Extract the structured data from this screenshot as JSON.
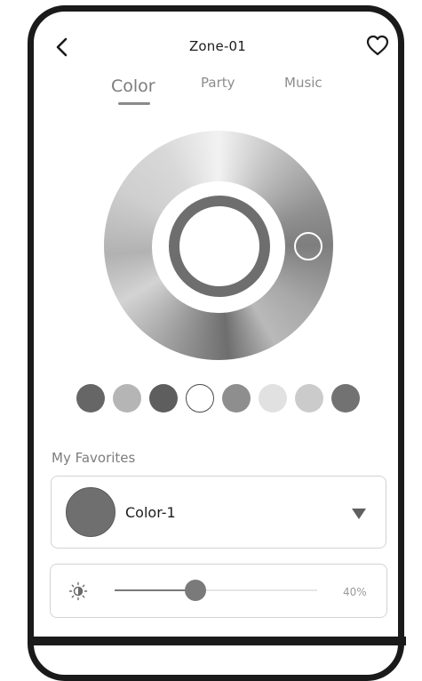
{
  "header": {
    "title": "Zone-01",
    "back_icon": "chevron-left-icon",
    "favorite_icon": "heart-icon"
  },
  "tabs": [
    {
      "label": "Color",
      "active": true
    },
    {
      "label": "Party",
      "active": false
    },
    {
      "label": "Music",
      "active": false
    }
  ],
  "color_wheel": {
    "selected_color": "#6e6e6e"
  },
  "swatches": [
    "#666666",
    "#b5b5b5",
    "#5e5e5e",
    "#ffffff",
    "#8e8e8e",
    "#e1e1e1",
    "#cbcbcb",
    "#727272"
  ],
  "favorites": {
    "label": "My Favorites",
    "selected": {
      "name": "Color-1",
      "color": "#6f6f6f"
    },
    "dropdown_icon": "triangle-down-icon"
  },
  "brightness": {
    "icon": "brightness-icon",
    "value": 40,
    "value_label": "40%"
  }
}
